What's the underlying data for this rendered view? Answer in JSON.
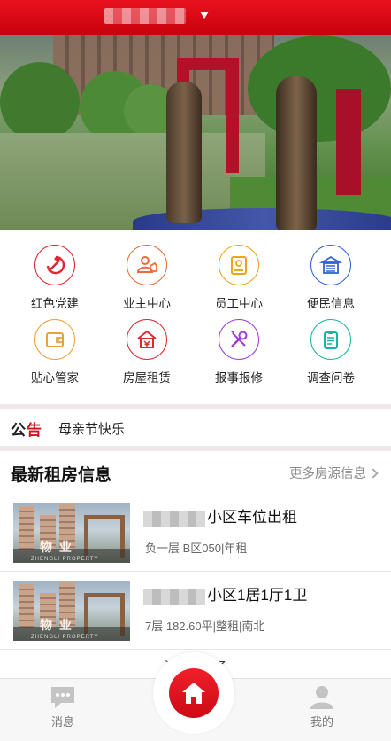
{
  "header": {
    "title": ""
  },
  "menu": [
    {
      "label": "红色党建",
      "icon": "party-emblem-icon",
      "color": "#e0262f"
    },
    {
      "label": "业主中心",
      "icon": "owner-user-icon",
      "color": "#ef6a3a"
    },
    {
      "label": "员工中心",
      "icon": "id-badge-icon",
      "color": "#f0a21a"
    },
    {
      "label": "便民信息",
      "icon": "info-board-icon",
      "color": "#2f63d8"
    },
    {
      "label": "贴心管家",
      "icon": "wallet-icon",
      "color": "#e9a23a"
    },
    {
      "label": "房屋租赁",
      "icon": "house-lease-icon",
      "color": "#e0262f"
    },
    {
      "label": "报事报修",
      "icon": "repair-tools-icon",
      "color": "#9a3bd6"
    },
    {
      "label": "调查问卷",
      "icon": "clipboard-survey-icon",
      "color": "#19b3a3"
    }
  ],
  "notice": {
    "tag_black": "公",
    "tag_red": "告",
    "text": "母亲节快乐"
  },
  "rentals": {
    "title": "最新租房信息",
    "more": "更多房源信息",
    "items": [
      {
        "title_suffix": "小区车位出租",
        "sub": "负一层 B区050|年租",
        "watermark": "物 业",
        "watermark_en": "ZHENGLI PROPERTY"
      },
      {
        "title_suffix": "小区1居1厅1卫",
        "sub": "7层 182.60平|整租|南北",
        "watermark": "物 业",
        "watermark_en": "ZHENGLI PROPERTY"
      }
    ],
    "end_text": "没有更多了"
  },
  "nav": {
    "messages": "消息",
    "home": "",
    "mine": "我的"
  },
  "colors": {
    "brand": "#d0121b",
    "divider": "#f1e7ea"
  }
}
